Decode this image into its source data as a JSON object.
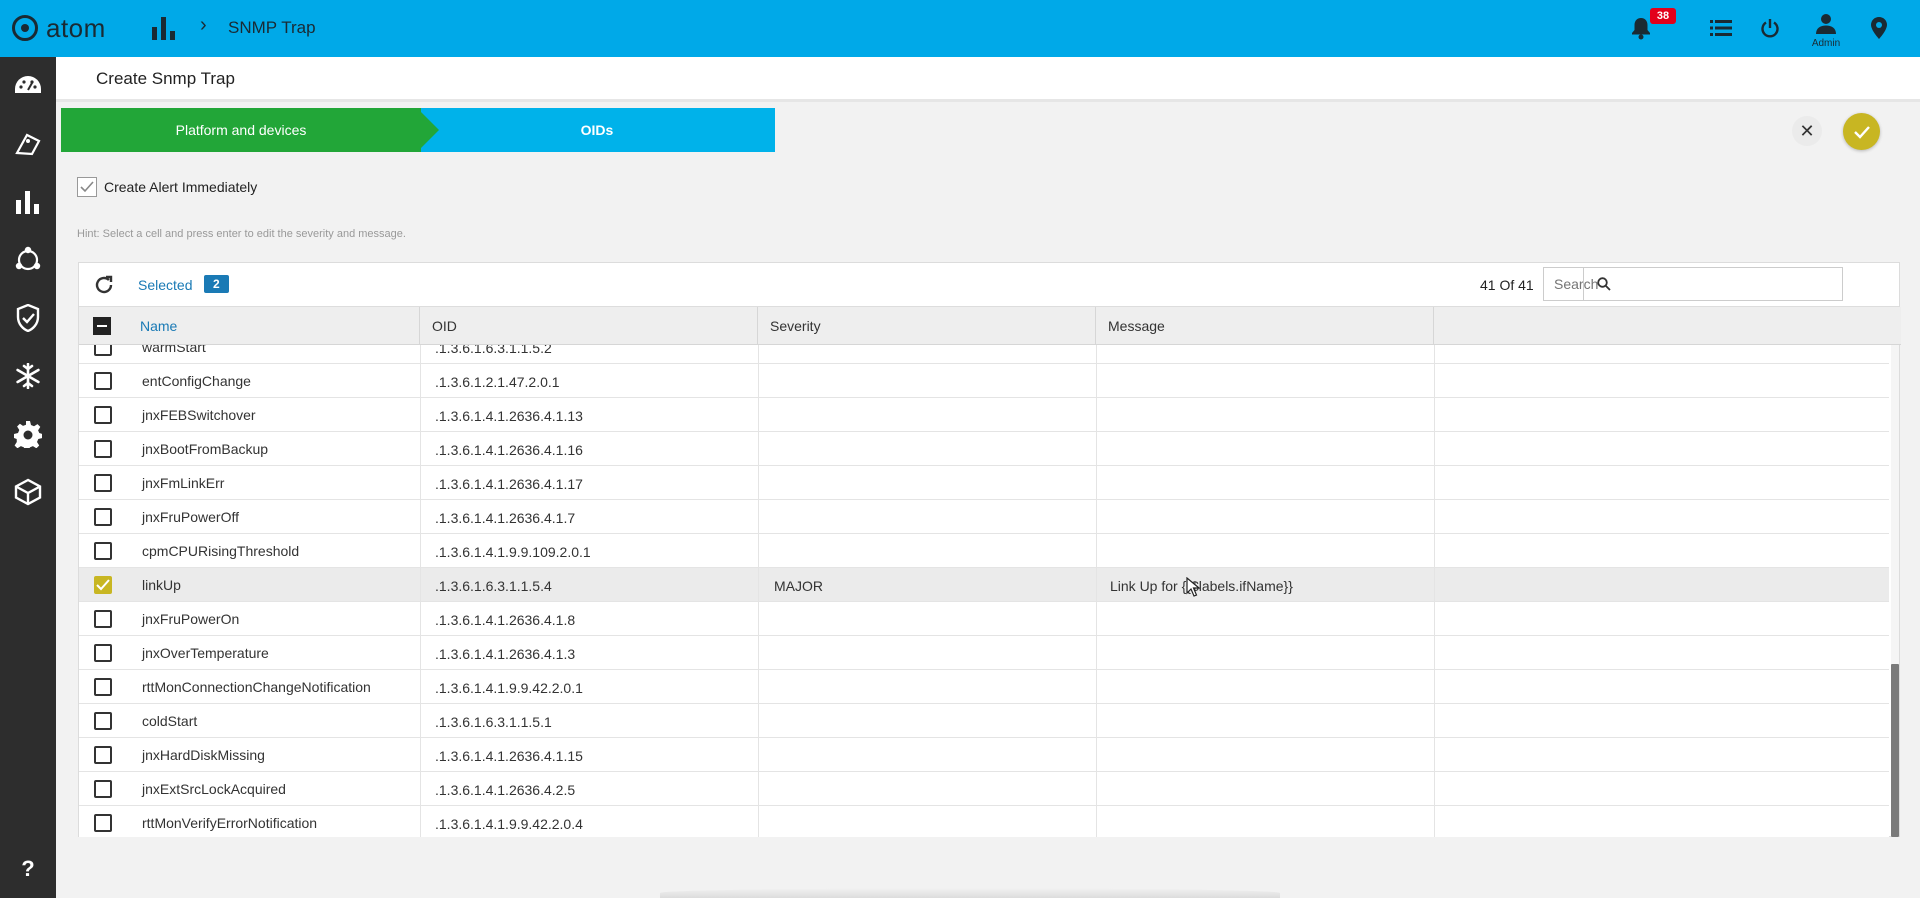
{
  "app": {
    "logo_text": "atom",
    "breadcrumb_title": "SNMP Trap",
    "notification_count": "38",
    "user_label": "Admin"
  },
  "page": {
    "title": "Create Snmp Trap"
  },
  "wizard": {
    "steps": [
      {
        "label": "Platform and devices",
        "color": "#22a638"
      },
      {
        "label": "OIDs",
        "color": "#00b2ea"
      }
    ]
  },
  "options": {
    "create_alert_label": "Create Alert Immediately",
    "create_alert_checked": true
  },
  "hint": "Hint: Select a cell and press enter to edit the severity and message.",
  "toolbar": {
    "selected_label": "Selected",
    "selected_count": "2",
    "count_text": "41 Of 41",
    "search_placeholder": "Search"
  },
  "table": {
    "columns": [
      "Name",
      "OID",
      "Severity",
      "Message"
    ],
    "rows": [
      {
        "name": "warmStart",
        "oid": ".1.3.6.1.6.3.1.1.5.2",
        "severity": "",
        "message": "",
        "checked": false
      },
      {
        "name": "entConfigChange",
        "oid": ".1.3.6.1.2.1.47.2.0.1",
        "severity": "",
        "message": "",
        "checked": false
      },
      {
        "name": "jnxFEBSwitchover",
        "oid": ".1.3.6.1.4.1.2636.4.1.13",
        "severity": "",
        "message": "",
        "checked": false
      },
      {
        "name": "jnxBootFromBackup",
        "oid": ".1.3.6.1.4.1.2636.4.1.16",
        "severity": "",
        "message": "",
        "checked": false
      },
      {
        "name": "jnxFmLinkErr",
        "oid": ".1.3.6.1.4.1.2636.4.1.17",
        "severity": "",
        "message": "",
        "checked": false
      },
      {
        "name": "jnxFruPowerOff",
        "oid": ".1.3.6.1.4.1.2636.4.1.7",
        "severity": "",
        "message": "",
        "checked": false
      },
      {
        "name": "cpmCPURisingThreshold",
        "oid": ".1.3.6.1.4.1.9.9.109.2.0.1",
        "severity": "",
        "message": "",
        "checked": false
      },
      {
        "name": "linkUp",
        "oid": ".1.3.6.1.6.3.1.1.5.4",
        "severity": "MAJOR",
        "message": "Link Up for {{$labels.ifName}}",
        "checked": true
      },
      {
        "name": "jnxFruPowerOn",
        "oid": ".1.3.6.1.4.1.2636.4.1.8",
        "severity": "",
        "message": "",
        "checked": false
      },
      {
        "name": "jnxOverTemperature",
        "oid": ".1.3.6.1.4.1.2636.4.1.3",
        "severity": "",
        "message": "",
        "checked": false
      },
      {
        "name": "rttMonConnectionChangeNotification",
        "oid": ".1.3.6.1.4.1.9.9.42.2.0.1",
        "severity": "",
        "message": "",
        "checked": false
      },
      {
        "name": "coldStart",
        "oid": ".1.3.6.1.6.3.1.1.5.1",
        "severity": "",
        "message": "",
        "checked": false
      },
      {
        "name": "jnxHardDiskMissing",
        "oid": ".1.3.6.1.4.1.2636.4.1.15",
        "severity": "",
        "message": "",
        "checked": false
      },
      {
        "name": "jnxExtSrcLockAcquired",
        "oid": ".1.3.6.1.4.1.2636.4.2.5",
        "severity": "",
        "message": "",
        "checked": false
      },
      {
        "name": "rttMonVerifyErrorNotification",
        "oid": ".1.3.6.1.4.1.9.9.42.2.0.4",
        "severity": "",
        "message": "",
        "checked": false
      }
    ]
  },
  "colors": {
    "topbar": "#00a9e8",
    "sidebar": "#2d2d2d",
    "accent": "#c8b622",
    "link": "#1a7ab5",
    "badge": "#e3001b"
  },
  "icons": {
    "sidebar": [
      "dashboard-icon",
      "tag-icon",
      "bar-chart-icon",
      "network-icon",
      "shield-check-icon",
      "snowflake-icon",
      "gear-icon",
      "cube-icon"
    ],
    "topbar": [
      "bell-icon",
      "list-icon",
      "power-icon",
      "user-icon",
      "location-pin-icon"
    ]
  }
}
